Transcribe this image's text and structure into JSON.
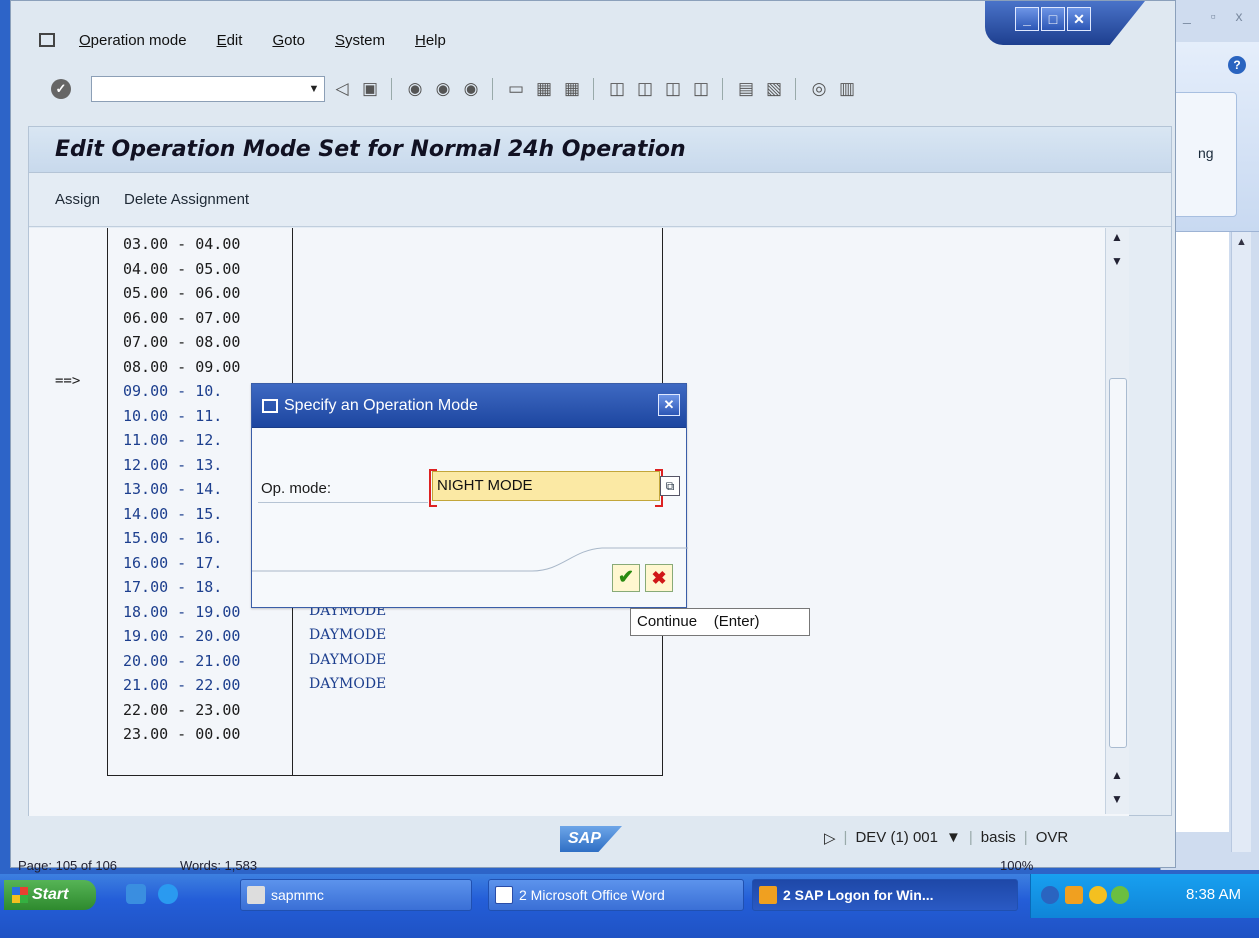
{
  "menubar": {
    "items": [
      "Operation mode",
      "Edit",
      "Goto",
      "System",
      "Help"
    ]
  },
  "toolbar": {
    "command_value": ""
  },
  "screen": {
    "title": "Edit Operation Mode Set for Normal 24h Operation",
    "buttons": [
      "Assign",
      "Delete Assignment"
    ]
  },
  "marker": "==>",
  "schedule": {
    "rows": [
      {
        "time": "03.00 - 04.00",
        "mode": ""
      },
      {
        "time": "04.00 - 05.00",
        "mode": ""
      },
      {
        "time": "05.00 - 06.00",
        "mode": ""
      },
      {
        "time": "06.00 - 07.00",
        "mode": ""
      },
      {
        "time": "07.00 - 08.00",
        "mode": ""
      },
      {
        "time": "08.00 - 09.00",
        "mode": ""
      },
      {
        "time": "09.00 - 10.",
        "mode": ""
      },
      {
        "time": "10.00 - 11.",
        "mode": ""
      },
      {
        "time": "11.00 - 12.",
        "mode": ""
      },
      {
        "time": "12.00 - 13.",
        "mode": ""
      },
      {
        "time": "13.00 - 14.",
        "mode": ""
      },
      {
        "time": "14.00 - 15.",
        "mode": ""
      },
      {
        "time": "15.00 - 16.",
        "mode": ""
      },
      {
        "time": "16.00 - 17.",
        "mode": ""
      },
      {
        "time": "17.00 - 18.",
        "mode": ""
      },
      {
        "time": "18.00 - 19.00",
        "mode": "DAYMODE"
      },
      {
        "time": "19.00 - 20.00",
        "mode": "DAYMODE"
      },
      {
        "time": "20.00 - 21.00",
        "mode": "DAYMODE"
      },
      {
        "time": "21.00 - 22.00",
        "mode": "DAYMODE"
      },
      {
        "time": "22.00 - 23.00",
        "mode": ""
      },
      {
        "time": "23.00 - 00.00",
        "mode": ""
      }
    ]
  },
  "dialog": {
    "title": "Specify an Operation Mode",
    "label": "Op. mode:",
    "value": "NIGHT MODE"
  },
  "tooltip": {
    "text": "Continue    (Enter)"
  },
  "statusbar": {
    "logo": "SAP",
    "system": "DEV (1) 001",
    "user": "basis",
    "mode": "OVR"
  },
  "word": {
    "ribbon_text": "ng",
    "status_page": "Page: 105 of 106",
    "status_words": "Words: 1,583",
    "zoom": "100%"
  },
  "taskbar": {
    "start": "Start",
    "tasks": [
      "sapmmc",
      "2 Microsoft Office Word",
      "2 SAP Logon for Win..."
    ],
    "clock": "8:38 AM"
  },
  "colors": {
    "sap_blue_text": "#1d3f8e",
    "input_highlight": "#fbe9a4",
    "ok_green": "#2a8a10",
    "cancel_red": "#d01818"
  }
}
